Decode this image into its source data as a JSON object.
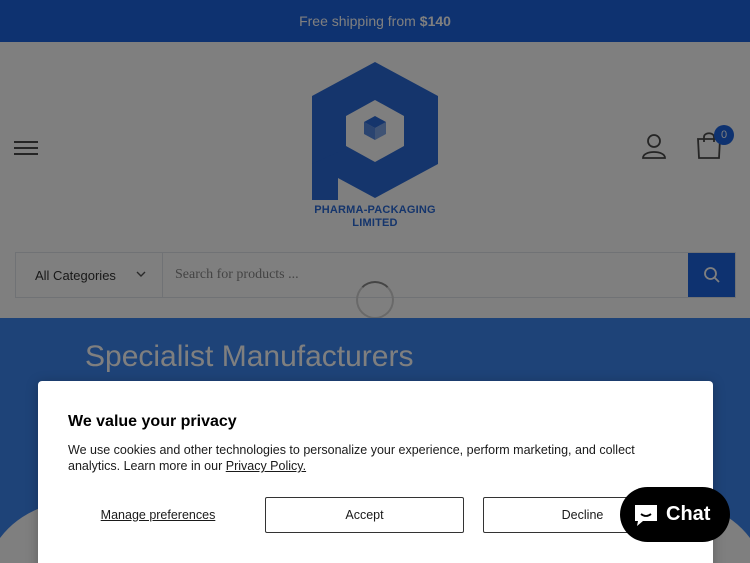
{
  "announcement": {
    "text": "Free shipping from",
    "amount": "$140"
  },
  "logo": {
    "line1": "PHARMA-PACKAGING",
    "line2": "LIMITED"
  },
  "cart": {
    "count": "0"
  },
  "search": {
    "category": "All Categories",
    "placeholder": "Search for products ..."
  },
  "hero": {
    "title": "Specialist Manufacturers"
  },
  "cookie": {
    "title": "We value your privacy",
    "text": "We use cookies and other technologies to personalize your experience, perform marketing, and collect analytics. Learn more in our",
    "link": "Privacy Policy.",
    "manage": "Manage preferences",
    "accept": "Accept",
    "decline": "Decline"
  },
  "chat": {
    "label": "Chat"
  },
  "icons": [
    "menu-icon",
    "user-icon",
    "bag-icon",
    "chevron-down-icon",
    "search-icon",
    "loading-spinner",
    "chat-bubble-icon"
  ],
  "colors": {
    "brand": "#1d64e0",
    "hero": "#3d86f0",
    "chat": "#000000"
  }
}
